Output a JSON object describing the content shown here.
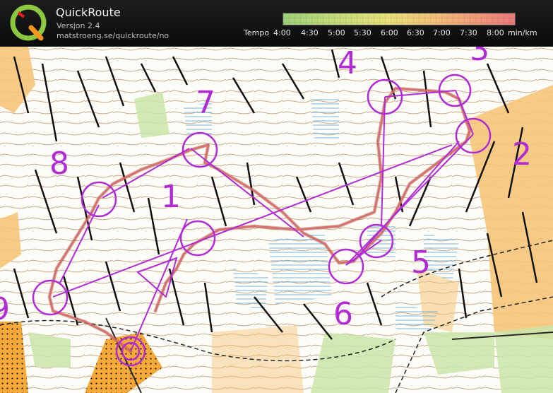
{
  "app": {
    "title": "QuickRoute",
    "version": "Versjon 2.4",
    "url": "matstroeng.se/quickroute/no",
    "logo_letter": "Q"
  },
  "pace_legend": {
    "label": "Tempo",
    "ticks": [
      "4:00",
      "4:30",
      "5:00",
      "5:30",
      "6:00",
      "6:30",
      "7:00",
      "7:30",
      "8:00"
    ],
    "unit": "min/km",
    "colors": [
      "#9fd07a",
      "#e7e07a",
      "#f2c07a",
      "#ea7a7a"
    ]
  },
  "map": {
    "course_color": "#b02bd6",
    "route_color": "#c9635a",
    "controls": [
      {
        "label": "1"
      },
      {
        "label": "2"
      },
      {
        "label": "3"
      },
      {
        "label": "4"
      },
      {
        "label": "5"
      },
      {
        "label": "6"
      },
      {
        "label": "7"
      },
      {
        "label": "8"
      },
      {
        "label": "9"
      }
    ]
  }
}
